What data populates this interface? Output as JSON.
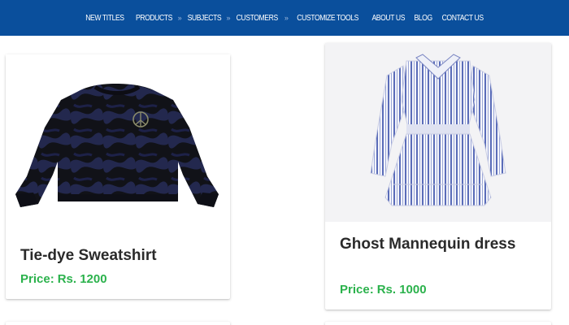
{
  "nav": {
    "items": [
      {
        "label": "NEW TITLES"
      },
      {
        "label": "PRODUCTS"
      },
      {
        "label": "SUBJECTS"
      },
      {
        "label": "CUSTOMERS"
      },
      {
        "label": "CUSTOMIZE TOOLS"
      },
      {
        "label": "ABOUT US"
      },
      {
        "label": "BLOG"
      },
      {
        "label": "CONTACT US"
      }
    ],
    "separator": "»"
  },
  "products": [
    {
      "title": "Tie-dye Sweatshirt",
      "price_prefix": "Price:",
      "price": "Rs. 1200",
      "image_icon": "sweatshirt-image"
    },
    {
      "title": "Ghost Mannequin dress",
      "price_prefix": "Price:",
      "price": "Rs. 1000",
      "image_icon": "dress-image"
    }
  ],
  "colors": {
    "nav_bg": "#0a4f9c",
    "price": "#2bb24c",
    "title": "#2a2a2a"
  }
}
